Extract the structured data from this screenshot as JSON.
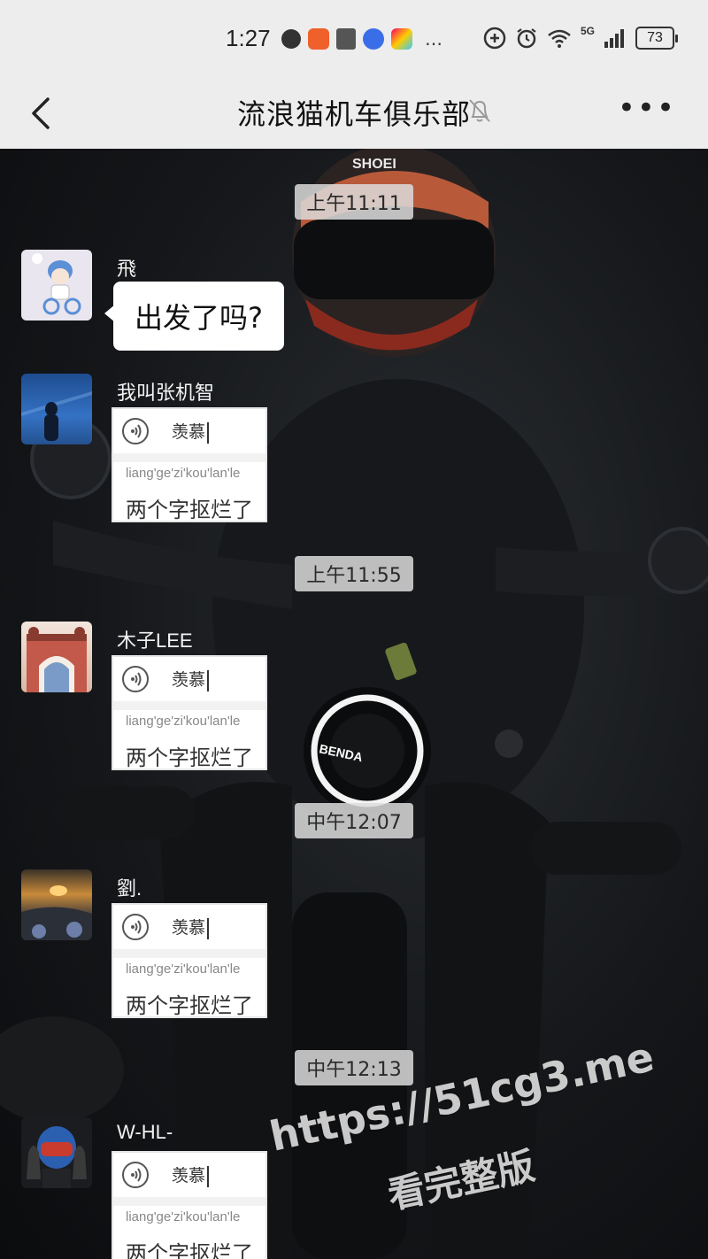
{
  "status_bar": {
    "time": "1:27",
    "network": "5G",
    "battery": "73",
    "more_icon": "…"
  },
  "header": {
    "title": "流浪猫机车俱乐部",
    "more": "•••"
  },
  "timestamps": [
    "上午11:11",
    "上午11:55",
    "中午12:07",
    "中午12:13"
  ],
  "messages": [
    {
      "sender": "飛",
      "text": "出发了吗?"
    },
    {
      "sender": "我叫张机智",
      "ime_word": "羡慕",
      "pinyin": "liang'ge'zi'kou'lan'le",
      "candidate": "两个字抠烂了"
    },
    {
      "sender": "木子LEE",
      "ime_word": "羡慕",
      "pinyin": "liang'ge'zi'kou'lan'le",
      "candidate": "两个字抠烂了"
    },
    {
      "sender": "劉.",
      "ime_word": "羡慕",
      "pinyin": "liang'ge'zi'kou'lan'le",
      "candidate": "两个字抠烂了"
    },
    {
      "sender": "W-HL-",
      "ime_word": "羡慕",
      "pinyin": "liang'ge'zi'kou'lan'le",
      "candidate": "两个字抠烂了"
    }
  ],
  "background": {
    "helmet_text": "SHOEI",
    "headlight_text": "BENDA"
  },
  "watermark": {
    "url": "https://51cg3.me",
    "caption": "看完整版"
  },
  "colors": {
    "bar_bg": "#ededed",
    "stamp_bg": "#dcdcdc",
    "bubble_bg": "#ffffff"
  }
}
